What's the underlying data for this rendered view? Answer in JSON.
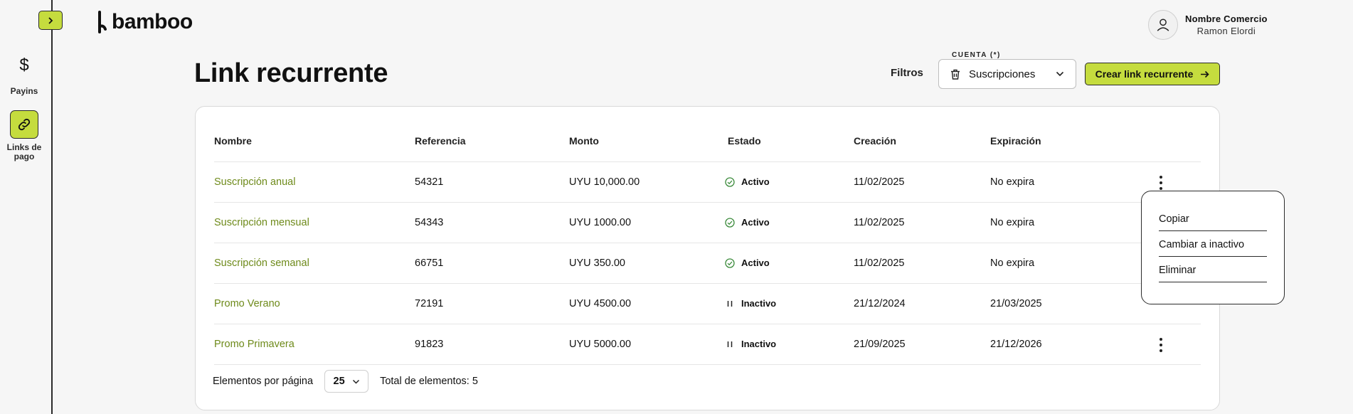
{
  "sidebar": {
    "items": [
      {
        "label": "Payins",
        "icon": "dollar-icon"
      },
      {
        "label": "Links de pago",
        "icon": "link-icon"
      }
    ]
  },
  "header": {
    "logo_text": "bamboo",
    "user": {
      "company": "Nombre Comercio",
      "name": "Ramon Elordi"
    }
  },
  "page": {
    "title": "Link recurrente",
    "filters_label": "Filtros",
    "account": {
      "legend": "CUENTA (*)",
      "value": "Suscripciones"
    },
    "create_button": "Crear link recurrente"
  },
  "table": {
    "headers": {
      "name": "Nombre",
      "reference": "Referencia",
      "amount": "Monto",
      "status": "Estado",
      "created": "Creación",
      "expires": "Expiración"
    },
    "rows": [
      {
        "name": "Suscripción anual",
        "reference": "54321",
        "amount": "UYU 10,000.00",
        "status": "Activo",
        "created": "11/02/2025",
        "expires": "No expira"
      },
      {
        "name": "Suscripción mensual",
        "reference": "54343",
        "amount": "UYU 1000.00",
        "status": "Activo",
        "created": "11/02/2025",
        "expires": "No expira"
      },
      {
        "name": "Suscripción semanal",
        "reference": "66751",
        "amount": "UYU 350.00",
        "status": "Activo",
        "created": "11/02/2025",
        "expires": "No expira"
      },
      {
        "name": "Promo Verano",
        "reference": "72191",
        "amount": "UYU 4500.00",
        "status": "Inactivo",
        "created": "21/12/2024",
        "expires": "21/03/2025"
      },
      {
        "name": "Promo Primavera",
        "reference": "91823",
        "amount": "UYU 5000.00",
        "status": "Inactivo",
        "created": "21/09/2025",
        "expires": "21/12/2026"
      }
    ],
    "footer": {
      "per_page_label": "Elementos por página",
      "per_page_value": "25",
      "total": "Total de elementos: 5"
    }
  },
  "context_menu": {
    "items": [
      "Copiar",
      "Cambiar a inactivo",
      "Eliminar"
    ]
  },
  "colors": {
    "accent": "#c5dc3e",
    "link_text": "#6e8a1a",
    "border_dark": "#2b2b2b"
  }
}
